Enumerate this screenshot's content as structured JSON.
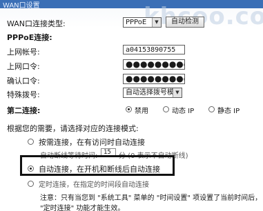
{
  "window": {
    "title": "WAN口设置"
  },
  "watermark": "khcoo.com",
  "wan_type": {
    "label": "WAN口连接类型:",
    "value": "PPPoE",
    "detect_button": "自动检测"
  },
  "pppoe_section": {
    "heading": "PPPoE连接:"
  },
  "account": {
    "label": "上网帐号:",
    "value": "a04153890755"
  },
  "password": {
    "label": "上网口令:",
    "mask": "●●●●●●●●●●●●●●●●"
  },
  "confirm_password": {
    "label": "确认口令:",
    "mask": "●●●●●●●●●●●●●●●●"
  },
  "special_dial": {
    "label": "特殊拨号:",
    "value": "自动选择拨号模式"
  },
  "second_connection": {
    "label": "第二连接:",
    "options": [
      "禁用",
      "动态 IP",
      "静态 IP"
    ],
    "selected": "禁用"
  },
  "mode_prompt": "根据您的需要，请选择对应的连接模式:",
  "modes": {
    "on_demand": "按需连接，在有访问时自动连接",
    "idle_text": "自动断线等待时间:",
    "idle_value": "15",
    "idle_unit": "分 (0 表示不自动断线)",
    "auto": "自动连接，在开机和断线后自动连接",
    "timed": "定时连接，在指定的时间段自动连接"
  },
  "note": {
    "line1": "注意：只有当您到 \"系统工具\" 菜单的 \"时间设置\" 项设置了当前时间后，",
    "line2": "\"定时连接\" 功能才能生效。"
  }
}
